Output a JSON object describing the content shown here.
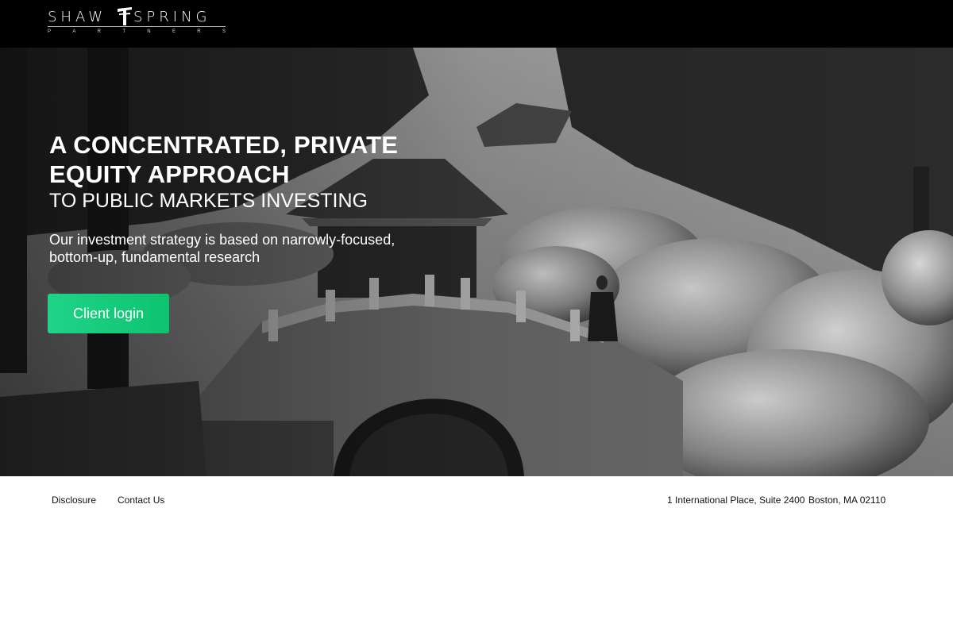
{
  "header": {
    "logo": {
      "word_left": "SHAW",
      "word_right": "SPRING",
      "subtitle_letters": [
        "P",
        "A",
        "R",
        "T",
        "N",
        "E",
        "R",
        "S"
      ]
    }
  },
  "hero": {
    "headline_line1": "A CONCENTRATED, PRIVATE",
    "headline_line2": "EQUITY APPROACH",
    "headline_line3": "TO PUBLIC MARKETS INVESTING",
    "tagline_line1": "Our investment strategy is based on narrowly-focused,",
    "tagline_line2": "bottom-up, fundamental research",
    "login_label": "Client login"
  },
  "footer": {
    "links": [
      "Disclosure",
      "Contact Us"
    ],
    "address_street": "1 International Place, Suite 2400",
    "address_city": "Boston, MA 02110"
  },
  "colors": {
    "header_bg": "#000000",
    "accent_green": "#1fd389",
    "footer_bg": "#ffffff"
  }
}
